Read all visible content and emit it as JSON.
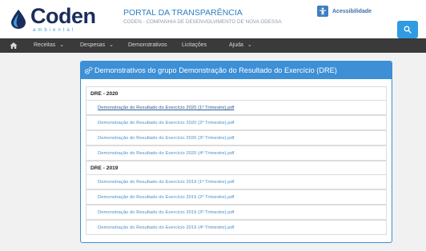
{
  "header": {
    "logo_text": "Coden",
    "logo_subtext": "ambiental",
    "portal_title": "PORTAL DA TRANSPARÊNCIA",
    "portal_subtitle": "CODEN - COMPANHIA DE DESENVOLVIMENTO DE NOVA ODESSA",
    "accessibility_label": "Acessibilidade",
    "colors": {
      "brand_navy": "#1a2d5c",
      "brand_blue": "#3aa0d8",
      "search_button": "#2f9be0"
    }
  },
  "nav": {
    "items": [
      {
        "label": "Receitas",
        "has_dropdown": true
      },
      {
        "label": "Despesas",
        "has_dropdown": true
      },
      {
        "label": "Demonstrativos",
        "has_dropdown": false
      },
      {
        "label": "Licitações",
        "has_dropdown": false
      },
      {
        "label": "Ajuda",
        "has_dropdown": true
      }
    ],
    "dropdown_symbol": "⌄"
  },
  "panel": {
    "title": "Demonstrativos do grupo Demonstração do Resultado do Exercício (DRE)",
    "header_color": "#3d8fd6",
    "groups": [
      {
        "label": "DRE - 2020",
        "files": [
          "Demonstração do Resultado do Exercício 2020 (1º Trimestre).pdf",
          "Demonstração do Resultado do Exercício 2020 (2º Trimestre).pdf",
          "Demonstração do Resultado do Exercício 2020 (3º Trimestre).pdf",
          "Demonstração do Resultado do Exercício 2020 (4º Trimestre).pdf"
        ]
      },
      {
        "label": "DRE - 2019",
        "files": [
          "Demonstração do Resultado do Exercício 2019 (1º Trimestre).pdf",
          "Demonstração do Resultado do Exercício 2019 (2º Trimestre).pdf",
          "Demonstração do Resultado do Exercício 2019 (3º Trimestre).pdf",
          "Demonstração do Resultado do Exercício 2019 (4º Trimestre).pdf"
        ]
      }
    ]
  }
}
